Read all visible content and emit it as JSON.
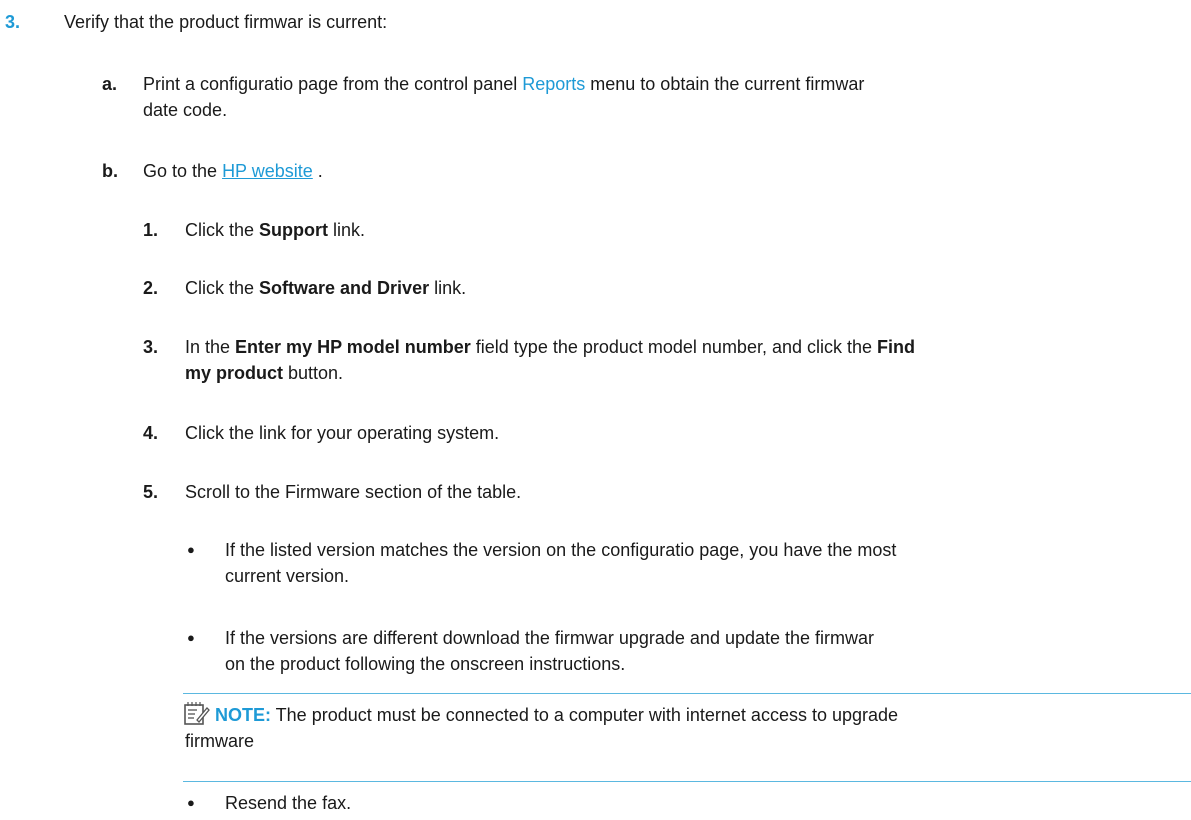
{
  "step3": {
    "number": "3.",
    "text": "Verify that the product firmwar   is current:"
  },
  "step_a": {
    "letter": "a.",
    "text_before": "Print a configuratio   page from the control panel ",
    "link": "Reports",
    "text_after": " menu to obtain the current firmwar",
    "line2": "date code."
  },
  "step_b": {
    "letter": "b.",
    "text_before": "Go to the ",
    "link": "HP website",
    "text_after": " ."
  },
  "substeps": [
    {
      "number": "1.",
      "before": "Click the ",
      "bold": "Support",
      "after": " link."
    },
    {
      "number": "2.",
      "before": "Click the ",
      "bold": "Software and Driver",
      "after": " link."
    },
    {
      "number": "3.",
      "before": "In the ",
      "bold": "Enter my HP model number",
      "after": " field  type the product model number, and click the ",
      "bold2": "Find",
      "line2_bold": "my product",
      "line2_after": " button."
    },
    {
      "number": "4.",
      "text": "Click the link for your operating system."
    },
    {
      "number": "5.",
      "text": "Scroll to the Firmware section of the table."
    }
  ],
  "bullets": [
    {
      "line1": "If the listed version matches the version on the configuratio   page, you have the most",
      "line2": "current version."
    },
    {
      "line1": "If the versions are different  download the firmwar   upgrade and update the firmwar",
      "line2": "on the product following the onscreen instructions."
    }
  ],
  "note": {
    "icon": "note-pad-icon",
    "label": "NOTE:",
    "line1": "   The product must be connected to a computer with internet access to upgrade",
    "line2": "firmware"
  },
  "final_bullet": "Resend the fax.",
  "bullet_glyph": "●",
  "colors": {
    "accent": "#1e9ad6",
    "rule": "#5bb8e0",
    "text": "#1a1a1a"
  }
}
